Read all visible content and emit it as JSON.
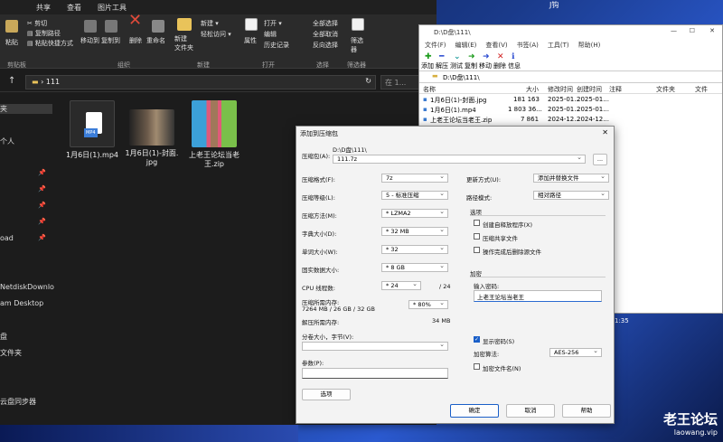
{
  "explorer": {
    "tabs": [
      "共享",
      "查看",
      "图片工具"
    ],
    "ribbon": {
      "paste": "粘贴",
      "cut": "剪切",
      "copy_path": "复制路径",
      "paste_shortcut": "粘贴快捷方式",
      "move_to": "移动到",
      "copy_to": "复制到",
      "delete": "删除",
      "rename": "重命名",
      "new_folder": "新建\n文件夹",
      "new_item": "新建 ▾",
      "easy_access": "轻松访问 ▾",
      "properties": "属性",
      "open": "打开 ▾",
      "edit": "编辑",
      "history": "历史记录",
      "select_all": "全部选择",
      "select_none": "全部取消",
      "invert": "反向选择",
      "filter": "筛选\n器",
      "groups": [
        "剪贴板",
        "组织",
        "新建",
        "打开",
        "选择",
        "筛选器"
      ]
    },
    "address": "111",
    "search_placeholder": "在 1...",
    "nav": [
      "夹",
      "个人",
      "oad",
      "NetdiskDownlo",
      "am Desktop",
      "盘",
      "文件夹",
      "云盘同步器"
    ],
    "files": [
      {
        "name": "1月6日(1).mp4",
        "badge": "MP4"
      },
      {
        "name": "1月6日(1)-封面.\njpg"
      },
      {
        "name": "上老王论坛当老\n王.zip"
      }
    ]
  },
  "fm": {
    "title": "D:\\D盘\\111\\",
    "menu": [
      "文件(F)",
      "编辑(E)",
      "查看(V)",
      "书签(A)",
      "工具(T)",
      "帮助(H)"
    ],
    "toolbar": [
      "添加",
      "解压",
      "测试",
      "复制",
      "移动",
      "删除",
      "信息"
    ],
    "path": "D:\\D盘\\111\\",
    "columns": [
      "名称",
      "大小",
      "修改时间",
      "创建时间",
      "注释",
      "文件夹",
      "文件"
    ],
    "rows": [
      {
        "name": "1月6日(1)-封面.jpg",
        "size": "181 163",
        "mtime": "2025-01...",
        "ctime": "2025-01..."
      },
      {
        "name": "1月6日(1).mp4",
        "size": "1 803 36...",
        "mtime": "2025-01...",
        "ctime": "2025-01..."
      },
      {
        "name": "上老王论坛当老王.zip",
        "size": "7 861",
        "mtime": "2024-12...",
        "ctime": "2024-12..."
      }
    ],
    "status_time": "1:35"
  },
  "dialog": {
    "title": "添加到压缩包",
    "archive_label": "压缩包(A):",
    "archive_dir": "D:\\D盘\\111\\",
    "archive_name": "111.7z",
    "browse": "...",
    "format_label": "压缩格式(F):",
    "format_value": "7z",
    "level_label": "压缩等级(L):",
    "level_value": "5 - 标准压缩",
    "method_label": "压缩方法(M):",
    "method_value": "* LZMA2",
    "dict_label": "字典大小(D):",
    "dict_value": "* 32 MB",
    "word_label": "单词大小(W):",
    "word_value": "* 32",
    "solid_label": "固实数据大小:",
    "solid_value": "* 8 GB",
    "cpu_label": "CPU 线程数:",
    "cpu_value": "* 24",
    "cpu_total": "/ 24",
    "mem_label": "压缩所需内存:",
    "mem_detail": "7264 MB / 26 GB / 32 GB",
    "mem_pct": "* 80%",
    "dmem_label": "解压所需内存:",
    "dmem_value": "34 MB",
    "split_label": "分卷大小，字节(V):",
    "params_label": "参数(P):",
    "options_btn": "选项",
    "update_label": "更新方式(U):",
    "update_value": "添加并替换文件",
    "pathmode_label": "路径模式:",
    "pathmode_value": "相对路径",
    "options_group": "选项",
    "opt_sfx": "创建自释放程序(X)",
    "opt_shared": "压缩共享文件",
    "opt_delete": "操作完成后删除源文件",
    "enc_group": "加密",
    "pw_label": "输入密码:",
    "pw_value": "上老王论坛当老王",
    "show_pw": "显示密码(S)",
    "enc_method_label": "加密算法:",
    "enc_method_value": "AES-256",
    "enc_names": "加密文件名(N)",
    "ok": "确定",
    "cancel": "取消",
    "help": "帮助"
  },
  "watermark": {
    "text": "老王论坛",
    "url": "laowang.vip"
  }
}
